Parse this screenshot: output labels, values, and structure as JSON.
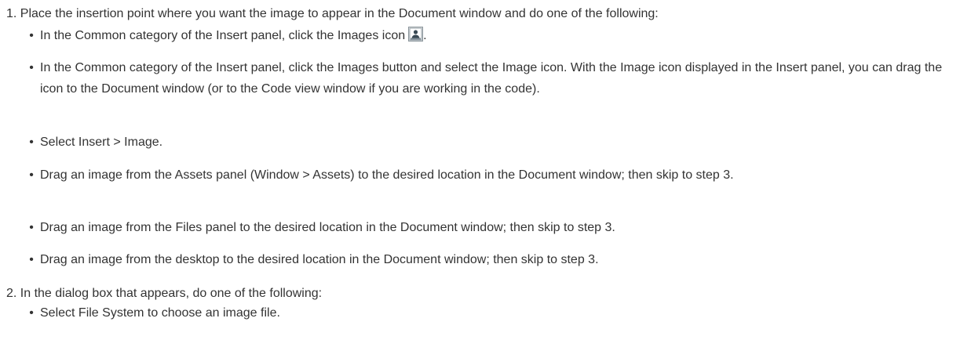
{
  "steps": [
    {
      "number": "1.",
      "text": "Place the insertion point where you want the image to appear in the Document window and do one of the following:",
      "bullets": [
        {
          "text": "In the Common category of the Insert panel, click the Images icon",
          "icon": "image-insert-icon",
          "suffix": "."
        },
        {
          "text": "In the Common category of the Insert panel, click the Images button and select the Image icon. With the Image icon displayed in the Insert panel, you can drag the icon to the Document window (or to the Code view window if you are working in the code)."
        },
        {
          "text": "Select Insert > Image."
        },
        {
          "text": "Drag an image from the Assets panel (Window > Assets) to the desired location in the Document window; then skip to step 3."
        },
        {
          "text": "Drag an image from the Files panel to the desired location in the Document window; then skip to step 3."
        },
        {
          "text": "Drag an image from the desktop to the desired location in the Document window; then skip to step 3."
        }
      ]
    },
    {
      "number": "2.",
      "text": "In the dialog box that appears, do one of the following:",
      "bullets": [
        {
          "text": "Select File System to choose an image file."
        }
      ]
    }
  ],
  "bullet_glyph": "•"
}
